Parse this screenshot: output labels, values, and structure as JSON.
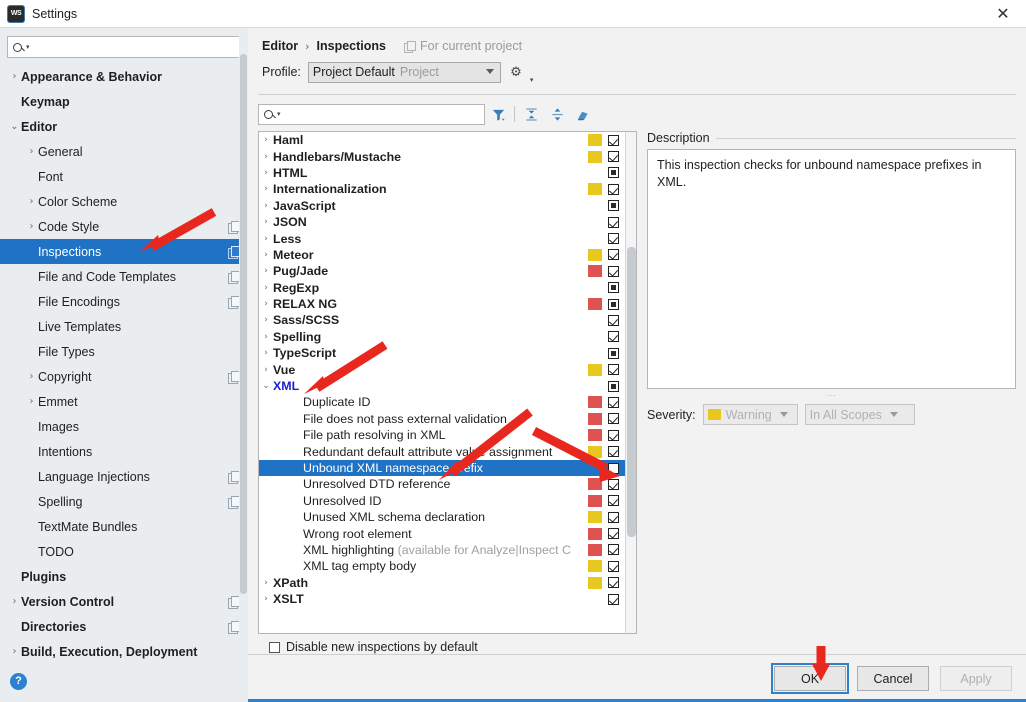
{
  "window": {
    "title": "Settings",
    "app_icon": "WS",
    "close_icon": "✕"
  },
  "sidebar": {
    "search": {
      "value": "",
      "placeholder": ""
    },
    "items": [
      {
        "label": "Appearance & Behavior",
        "indent": 0,
        "arrow": "›",
        "bold": true,
        "copy": false,
        "selected": false
      },
      {
        "label": "Keymap",
        "indent": 0,
        "arrow": "",
        "bold": true,
        "copy": false,
        "selected": false
      },
      {
        "label": "Editor",
        "indent": 0,
        "arrow": "⌄",
        "bold": true,
        "copy": false,
        "selected": false
      },
      {
        "label": "General",
        "indent": 1,
        "arrow": "›",
        "bold": false,
        "copy": false,
        "selected": false
      },
      {
        "label": "Font",
        "indent": 1,
        "arrow": "",
        "bold": false,
        "copy": false,
        "selected": false
      },
      {
        "label": "Color Scheme",
        "indent": 1,
        "arrow": "›",
        "bold": false,
        "copy": false,
        "selected": false
      },
      {
        "label": "Code Style",
        "indent": 1,
        "arrow": "›",
        "bold": false,
        "copy": true,
        "selected": false
      },
      {
        "label": "Inspections",
        "indent": 1,
        "arrow": "",
        "bold": false,
        "copy": true,
        "selected": true
      },
      {
        "label": "File and Code Templates",
        "indent": 1,
        "arrow": "",
        "bold": false,
        "copy": true,
        "selected": false
      },
      {
        "label": "File Encodings",
        "indent": 1,
        "arrow": "",
        "bold": false,
        "copy": true,
        "selected": false
      },
      {
        "label": "Live Templates",
        "indent": 1,
        "arrow": "",
        "bold": false,
        "copy": false,
        "selected": false
      },
      {
        "label": "File Types",
        "indent": 1,
        "arrow": "",
        "bold": false,
        "copy": false,
        "selected": false
      },
      {
        "label": "Copyright",
        "indent": 1,
        "arrow": "›",
        "bold": false,
        "copy": true,
        "selected": false
      },
      {
        "label": "Emmet",
        "indent": 1,
        "arrow": "›",
        "bold": false,
        "copy": false,
        "selected": false
      },
      {
        "label": "Images",
        "indent": 1,
        "arrow": "",
        "bold": false,
        "copy": false,
        "selected": false
      },
      {
        "label": "Intentions",
        "indent": 1,
        "arrow": "",
        "bold": false,
        "copy": false,
        "selected": false
      },
      {
        "label": "Language Injections",
        "indent": 1,
        "arrow": "",
        "bold": false,
        "copy": true,
        "selected": false
      },
      {
        "label": "Spelling",
        "indent": 1,
        "arrow": "",
        "bold": false,
        "copy": true,
        "selected": false
      },
      {
        "label": "TextMate Bundles",
        "indent": 1,
        "arrow": "",
        "bold": false,
        "copy": false,
        "selected": false
      },
      {
        "label": "TODO",
        "indent": 1,
        "arrow": "",
        "bold": false,
        "copy": false,
        "selected": false
      },
      {
        "label": "Plugins",
        "indent": 0,
        "arrow": "",
        "bold": true,
        "copy": false,
        "selected": false
      },
      {
        "label": "Version Control",
        "indent": 0,
        "arrow": "›",
        "bold": true,
        "copy": true,
        "selected": false
      },
      {
        "label": "Directories",
        "indent": 0,
        "arrow": "",
        "bold": true,
        "copy": true,
        "selected": false
      },
      {
        "label": "Build, Execution, Deployment",
        "indent": 0,
        "arrow": "›",
        "bold": true,
        "copy": false,
        "selected": false
      }
    ],
    "help_icon": "?"
  },
  "header": {
    "breadcrumb_parent": "Editor",
    "breadcrumb_sep": "›",
    "breadcrumb_current": "Inspections",
    "scope_hint": "For current project",
    "profile_label": "Profile:",
    "profile_value": "Project Default",
    "profile_scope": "Project"
  },
  "toolbar": {
    "search": {
      "value": "",
      "placeholder": ""
    },
    "buttons": [
      {
        "name": "filter-icon",
        "title": "Filter inspections"
      },
      {
        "name": "expand-all-icon",
        "title": "Expand all"
      },
      {
        "name": "collapse-all-icon",
        "title": "Collapse all"
      },
      {
        "name": "reset-icon",
        "title": "Reset to defaults"
      }
    ]
  },
  "inspections": {
    "rows": [
      {
        "label": "Haml",
        "indent": 0,
        "arrow": "›",
        "bold": true,
        "severity": "yellow",
        "check": "checked"
      },
      {
        "label": "Handlebars/Mustache",
        "indent": 0,
        "arrow": "›",
        "bold": true,
        "severity": "yellow",
        "check": "checked"
      },
      {
        "label": "HTML",
        "indent": 0,
        "arrow": "›",
        "bold": true,
        "severity": "none",
        "check": "partial"
      },
      {
        "label": "Internationalization",
        "indent": 0,
        "arrow": "›",
        "bold": true,
        "severity": "yellow",
        "check": "checked"
      },
      {
        "label": "JavaScript",
        "indent": 0,
        "arrow": "›",
        "bold": true,
        "severity": "none",
        "check": "partial"
      },
      {
        "label": "JSON",
        "indent": 0,
        "arrow": "›",
        "bold": true,
        "severity": "none",
        "check": "checked"
      },
      {
        "label": "Less",
        "indent": 0,
        "arrow": "›",
        "bold": true,
        "severity": "none",
        "check": "checked"
      },
      {
        "label": "Meteor",
        "indent": 0,
        "arrow": "›",
        "bold": true,
        "severity": "yellow",
        "check": "checked"
      },
      {
        "label": "Pug/Jade",
        "indent": 0,
        "arrow": "›",
        "bold": true,
        "severity": "red",
        "check": "checked"
      },
      {
        "label": "RegExp",
        "indent": 0,
        "arrow": "›",
        "bold": true,
        "severity": "none",
        "check": "partial"
      },
      {
        "label": "RELAX NG",
        "indent": 0,
        "arrow": "›",
        "bold": true,
        "severity": "red",
        "check": "partial"
      },
      {
        "label": "Sass/SCSS",
        "indent": 0,
        "arrow": "›",
        "bold": true,
        "severity": "none",
        "check": "checked"
      },
      {
        "label": "Spelling",
        "indent": 0,
        "arrow": "›",
        "bold": true,
        "severity": "none",
        "check": "checked"
      },
      {
        "label": "TypeScript",
        "indent": 0,
        "arrow": "›",
        "bold": true,
        "severity": "none",
        "check": "partial"
      },
      {
        "label": "Vue",
        "indent": 0,
        "arrow": "›",
        "bold": true,
        "severity": "yellow",
        "check": "checked"
      },
      {
        "label": "XML",
        "indent": 0,
        "arrow": "⌄",
        "bold": true,
        "xmlhead": true,
        "severity": "none",
        "check": "partial"
      },
      {
        "label": "Duplicate ID",
        "indent": 1,
        "arrow": "",
        "bold": false,
        "severity": "red",
        "check": "checked"
      },
      {
        "label": "File does not pass external validation",
        "indent": 1,
        "arrow": "",
        "bold": false,
        "severity": "red",
        "check": "checked"
      },
      {
        "label": "File path resolving in XML",
        "indent": 1,
        "arrow": "",
        "bold": false,
        "severity": "red",
        "check": "checked"
      },
      {
        "label": "Redundant default attribute value assignment",
        "indent": 1,
        "arrow": "",
        "bold": false,
        "severity": "yellow",
        "check": "checked"
      },
      {
        "label": "Unbound XML namespace prefix",
        "indent": 1,
        "arrow": "",
        "bold": false,
        "severity": "none",
        "check": "empty",
        "selected": true
      },
      {
        "label": "Unresolved DTD reference",
        "indent": 1,
        "arrow": "",
        "bold": false,
        "severity": "red",
        "check": "checked"
      },
      {
        "label": "Unresolved ID",
        "indent": 1,
        "arrow": "",
        "bold": false,
        "severity": "red",
        "check": "checked"
      },
      {
        "label": "Unused XML schema declaration",
        "indent": 1,
        "arrow": "",
        "bold": false,
        "severity": "yellow",
        "check": "checked"
      },
      {
        "label": "Wrong root element",
        "indent": 1,
        "arrow": "",
        "bold": false,
        "severity": "red",
        "check": "checked"
      },
      {
        "label": "XML highlighting",
        "hint": "(available for Analyze|Inspect C",
        "indent": 1,
        "arrow": "",
        "bold": false,
        "severity": "red",
        "check": "checked"
      },
      {
        "label": "XML tag empty body",
        "indent": 1,
        "arrow": "",
        "bold": false,
        "severity": "yellow",
        "check": "checked"
      },
      {
        "label": "XPath",
        "indent": 0,
        "arrow": "›",
        "bold": true,
        "severity": "yellow",
        "check": "checked"
      },
      {
        "label": "XSLT",
        "indent": 0,
        "arrow": "›",
        "bold": true,
        "severity": "none",
        "check": "checked"
      }
    ]
  },
  "description": {
    "title": "Description",
    "body": "This inspection checks for unbound namespace prefixes in XML."
  },
  "severity": {
    "label": "Severity:",
    "value": "Warning",
    "scope_value": "In All Scopes"
  },
  "options": {
    "disable_new_label": "Disable new inspections by default",
    "disable_new_checked": false
  },
  "footer": {
    "ok": "OK",
    "cancel": "Cancel",
    "apply": "Apply"
  },
  "colors": {
    "accent": "#1f72c4",
    "warning_yellow": "#e8c81e",
    "error_red": "#e05252",
    "annotation_red": "#e8271f"
  }
}
